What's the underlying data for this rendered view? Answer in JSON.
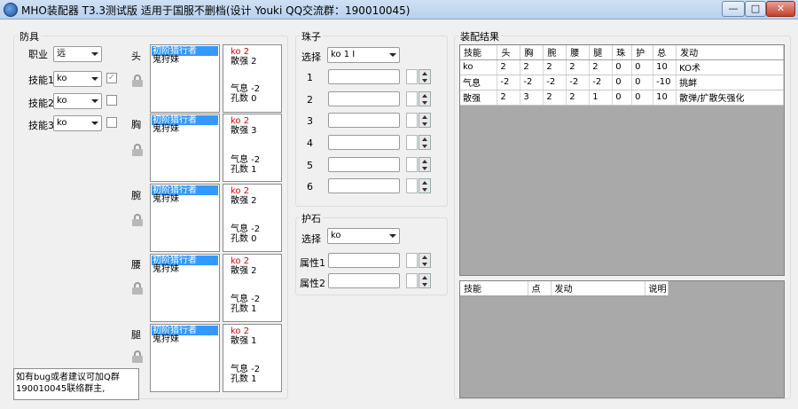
{
  "window": {
    "title": "MHO装配器 T3.3测试版 适用于国服不删档(设计 Youki QQ交流群：190010045)",
    "min_glyph": "—",
    "max_glyph": "□",
    "close_glyph": "✕"
  },
  "armor": {
    "group_title": "防具",
    "job_label": "职业",
    "job_value": "远",
    "skill1_label": "技能1",
    "skill1_value": "ko",
    "skill1_checked": "✓",
    "skill2_label": "技能2",
    "skill2_value": "ko",
    "skill3_label": "技能3",
    "skill3_value": "ko",
    "slots": [
      {
        "part": "头",
        "selected": "初阶猎行者",
        "item2": "鬼狩妹",
        "s1": "ko 2",
        "s2": "散强 2",
        "s3": "气息 -2",
        "s4": "孔数 0"
      },
      {
        "part": "胸",
        "selected": "初阶猎行者",
        "item2": "鬼狩妹",
        "s1": "ko 2",
        "s2": "散强 3",
        "s3": "气息 -2",
        "s4": "孔数 1"
      },
      {
        "part": "腕",
        "selected": "初阶猎行者",
        "item2": "鬼狩妹",
        "s1": "ko 2",
        "s2": "散强 2",
        "s3": "气息 -2",
        "s4": "孔数 0"
      },
      {
        "part": "腰",
        "selected": "初阶猎行者",
        "item2": "鬼狩妹",
        "s1": "ko 2",
        "s2": "散强 2",
        "s3": "气息 -2",
        "s4": "孔数 1"
      },
      {
        "part": "腿",
        "selected": "初阶猎行者",
        "item2": "鬼狩妹",
        "s1": "ko 2",
        "s2": "散强 1",
        "s3": "气息 -2",
        "s4": "孔数 1"
      }
    ]
  },
  "jewels": {
    "group_title": "珠子",
    "select_label": "选择",
    "select_value": "ko 1 I",
    "rows": [
      {
        "label": "1",
        "count": ""
      },
      {
        "label": "2",
        "count": ""
      },
      {
        "label": "3",
        "count": ""
      },
      {
        "label": "4",
        "count": ""
      },
      {
        "label": "5",
        "count": ""
      },
      {
        "label": "6",
        "count": ""
      }
    ]
  },
  "charm": {
    "group_title": "护石",
    "select_label": "选择",
    "select_value": "ko",
    "attr1_label": "属性1",
    "attr2_label": "属性2"
  },
  "result": {
    "group_title": "装配结果",
    "headers": [
      "技能",
      "头",
      "胸",
      "腕",
      "腰",
      "腿",
      "珠",
      "护",
      "总",
      "发动"
    ],
    "rows": [
      [
        "ko",
        "2",
        "2",
        "2",
        "2",
        "2",
        "0",
        "0",
        "10",
        "KO术"
      ],
      [
        "气息",
        "-2",
        "-2",
        "-2",
        "-2",
        "-2",
        "0",
        "0",
        "-10",
        "挑衅"
      ],
      [
        "散强",
        "2",
        "3",
        "2",
        "2",
        "1",
        "0",
        "0",
        "10",
        "散弹/扩散矢强化"
      ]
    ]
  },
  "skills_table": {
    "headers": [
      "技能",
      "点",
      "发动",
      "说明"
    ]
  },
  "bug_note": {
    "line1": "如有bug或者建议可加Q群",
    "line2": "190010045联络群主,"
  }
}
